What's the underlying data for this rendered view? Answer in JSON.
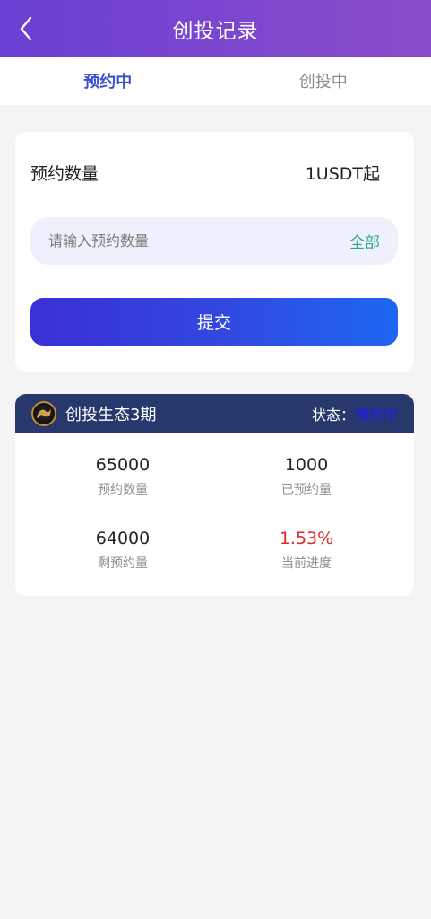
{
  "header": {
    "title": "创投记录",
    "back_icon": "chevron-left-icon"
  },
  "tabs": [
    {
      "label": "预约中",
      "active": true
    },
    {
      "label": "创投中",
      "active": false
    }
  ],
  "reserve_form": {
    "label": "预约数量",
    "min_text": "1USDT起",
    "input_placeholder": "请输入预约数量",
    "input_value": "",
    "all_label": "全部",
    "submit_label": "提交"
  },
  "project": {
    "name": "创投生态3期",
    "logo_icon": "project-logo-icon",
    "status_label": "状态：",
    "status_value": "预约中",
    "stats": [
      {
        "value": "65000",
        "label": "预约数量"
      },
      {
        "value": "1000",
        "label": "已预约量"
      },
      {
        "value": "64000",
        "label": "剩预约量"
      },
      {
        "value": "1.53%",
        "label": "当前进度"
      }
    ]
  },
  "colors": {
    "header_gradient_start": "#6a3fd3",
    "header_gradient_end": "#8a4cc8",
    "tab_active": "#3a4fd0",
    "submit_gradient_start": "#3a2fd6",
    "submit_gradient_end": "#1e66f2",
    "project_header_bg": "#26386c",
    "status_value": "#1a1aff",
    "progress_value": "#e02828",
    "all_link": "#2aa69a"
  }
}
